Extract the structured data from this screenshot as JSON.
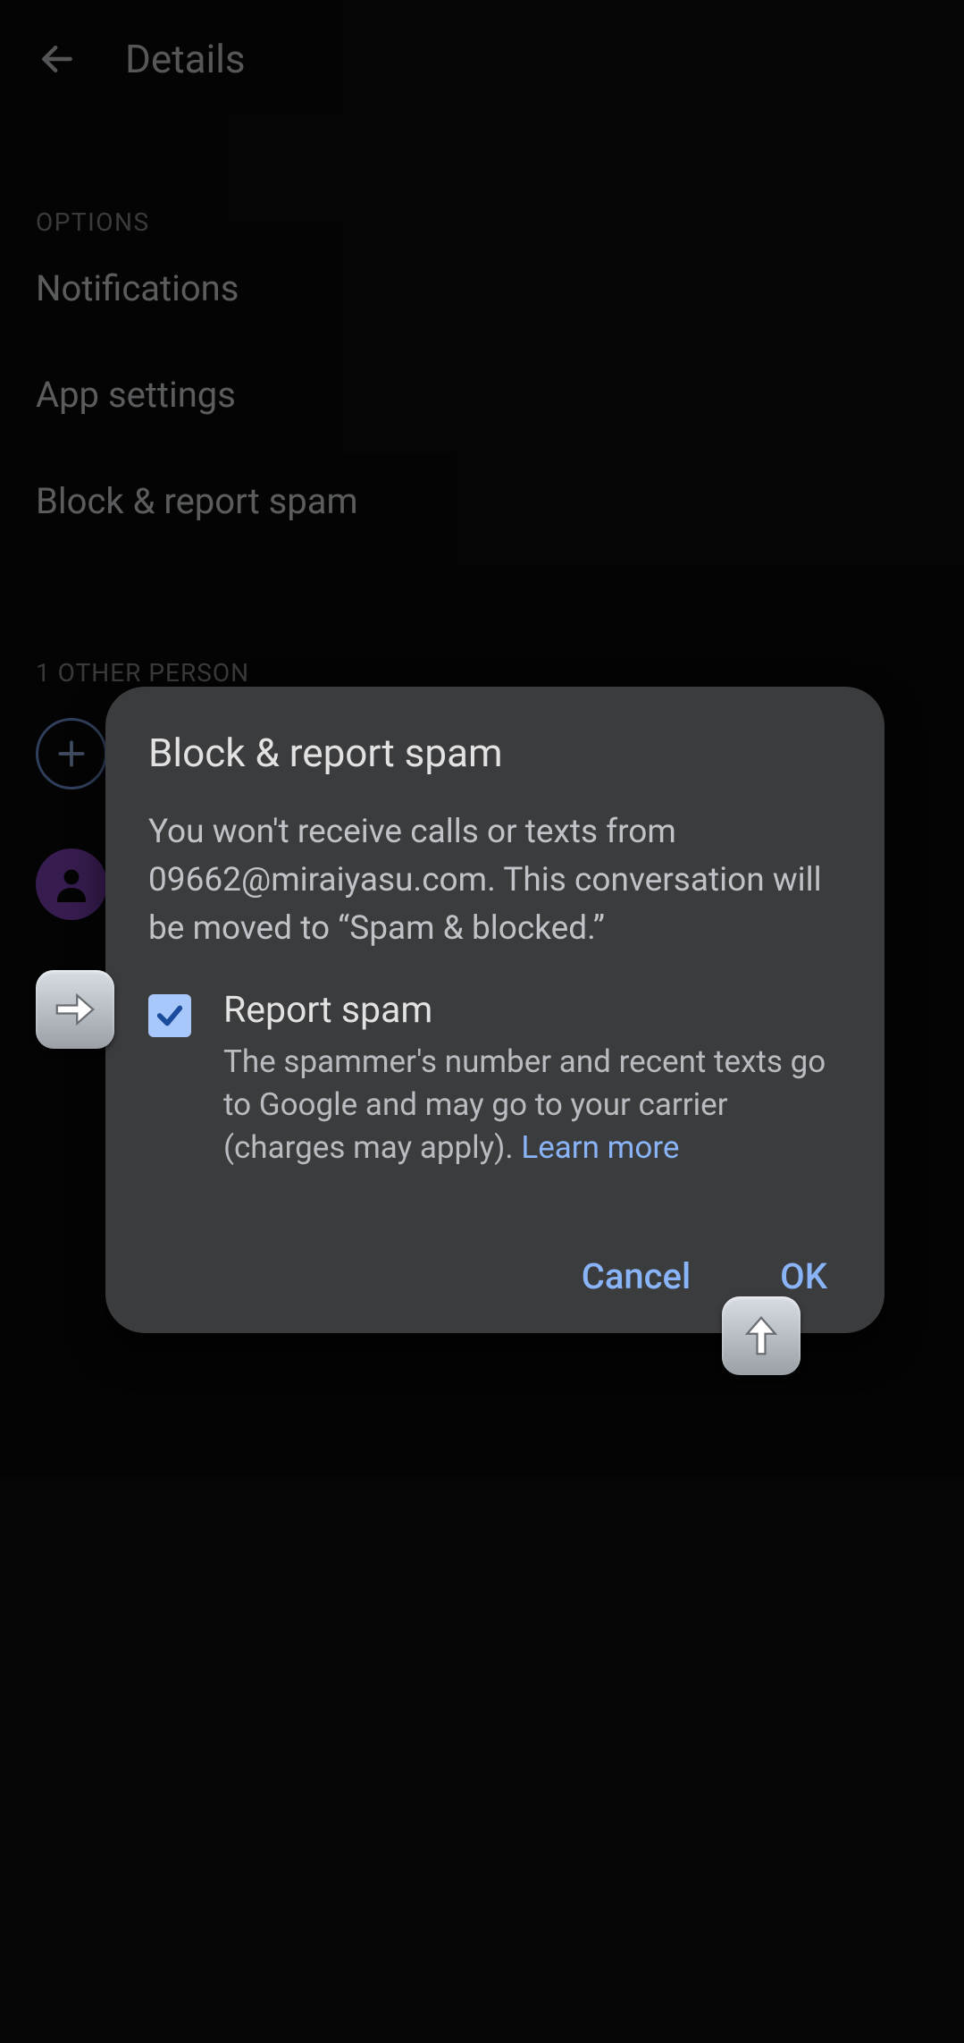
{
  "header": {
    "title": "Details"
  },
  "sections": {
    "options_label": "OPTIONS",
    "options": {
      "notifications": "Notifications",
      "app_settings": "App settings",
      "block_report": "Block & report spam"
    },
    "people_label": "1 OTHER PERSON"
  },
  "dialog": {
    "title": "Block & report spam",
    "body": "You won't receive calls or texts from 09662@miraiyasu.com. This conversation will be moved to “Spam & blocked.”",
    "checkbox": {
      "checked": true,
      "title": "Report spam",
      "subtitle": "The spammer's number and recent texts go to Google and may go to your carrier (charges may apply). ",
      "learn_more": "Learn more"
    },
    "actions": {
      "cancel": "Cancel",
      "ok": "OK"
    }
  }
}
